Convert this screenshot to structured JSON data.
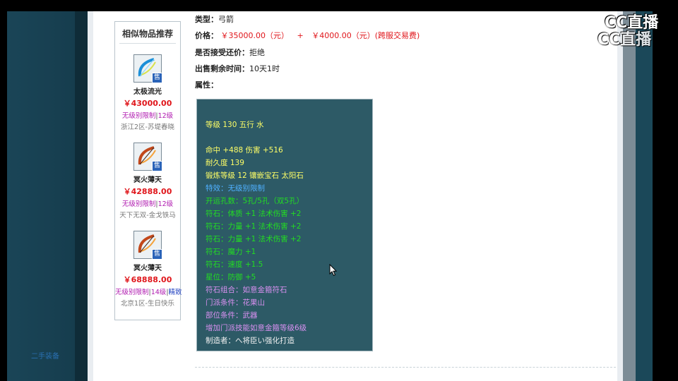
{
  "info": {
    "type_label": "类型：",
    "type_value": "弓箭",
    "price_label": "价格：",
    "price_value": "￥35000.00（元）",
    "price_plus": "+",
    "price_fee": "￥4000.00（元）(跨服交易费)",
    "counter_offer_label": "是否接受还价：",
    "counter_offer_value": "拒绝",
    "time_left_label": "出售剩余时间：",
    "time_left_value": "10天1时",
    "attrs_label": "属性："
  },
  "similar": {
    "title": "相似物品推荐",
    "badge": "售",
    "items": [
      {
        "name": "太极流光",
        "price": "￥43000.00",
        "tag1": "无级别限制",
        "tag2": "12级",
        "tag3": "",
        "server": "浙江2区-苏堤春晓",
        "icon": "bow-blue-icon"
      },
      {
        "name": "冥火薄天",
        "price": "￥42888.00",
        "tag1": "无级别限制",
        "tag2": "12级",
        "tag3": "",
        "server": "天下无双-金戈铁马",
        "icon": "bow-fire-icon"
      },
      {
        "name": "冥火薄天",
        "price": "￥68888.00",
        "tag1": "无级别限制",
        "tag2": "14级",
        "tag3": "精致",
        "server": "北京1区-生日快乐",
        "icon": "bow-fire-icon"
      }
    ]
  },
  "attributes": [
    {
      "text": "等级 130 五行 水",
      "color": "yellow"
    },
    {
      "text": "命中 +488 伤害 +516",
      "color": "yellow"
    },
    {
      "text": "耐久度 139",
      "color": "yellow"
    },
    {
      "text": "锻炼等级 12 镶嵌宝石 太阳石",
      "color": "yellow"
    },
    {
      "text": "特效：无级别限制",
      "color": "blue"
    },
    {
      "text": "开运孔数：5孔/5孔（双5孔）",
      "color": "green"
    },
    {
      "text": "符石：体质 +1 法术伤害 +2",
      "color": "green"
    },
    {
      "text": "符石：力量 +1 法术伤害 +2",
      "color": "green"
    },
    {
      "text": "符石：力量 +1 法术伤害 +2",
      "color": "green"
    },
    {
      "text": "符石：魔力 +1",
      "color": "green"
    },
    {
      "text": "符石：速度 +1.5",
      "color": "green"
    },
    {
      "text": "星位：防御 +5",
      "color": "green"
    },
    {
      "text": "符石组合：如意金箍符石",
      "color": "purple"
    },
    {
      "text": "门派条件：花果山",
      "color": "purple"
    },
    {
      "text": "部位条件：武器",
      "color": "purple"
    },
    {
      "text": "增加门派技能如意金箍等级6级",
      "color": "purple"
    },
    {
      "text": "制造者：へ将臣い强化打造",
      "color": "white"
    }
  ],
  "left_link": "二手装备",
  "watermark": {
    "line1": "CC直播",
    "line2": "CC直播"
  },
  "colors": {
    "price_red": "#e0161b",
    "attr_bg": "#2d5a66",
    "tag_purple": "#b01bb0"
  }
}
